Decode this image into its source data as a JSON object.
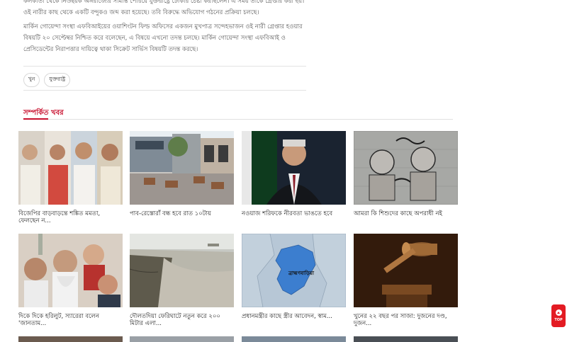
{
  "article": {
    "paragraphs": [
      "কলকাতা থেকে নিউইয়র্ক অঙ্গরাজ্যের সীমান্ত পেরিয়ে যুক্তরাষ্ট্রে ঢোকার চেষ্টা করছিলেন। এ সময় তাকে গ্রেপ্তার করা হয়। ওই নারীর কাছ থেকে একটি বন্দুকও জব্দ করা হয়েছে। তবি বিরুদ্ধে অভিযোগ গঠনের প্রক্রিয়া চলছে।",
      "মার্কিন গোয়েন্দা সংস্থা এফবিআইয়ের ওয়াশিংটন ফিল্ড অফিসের একজন মুখপাত্র সন্দেহভাজন ওই নারী গ্রেপ্তার হওয়ার বিষয়টি ২০ সেপ্টেম্বর নিশ্চিত করে বলেছেন, এ বিষয়ে এখনো তদন্ত চলছে। মার্কিন গোয়েন্দা সংস্থা এফবিআই ও প্রেসিডেন্টের নিরাপত্তার দায়িত্বে থাকা সিক্রেট সার্ভিস বিষয়টি তদন্ত করছে।"
    ],
    "tags": [
      "খুন",
      "যুক্তরাষ্ট্র"
    ]
  },
  "related": {
    "title": "সম্পর্কিত খবর",
    "items": [
      {
        "caption": "বিজেপির বাড়বাড়ন্তে শঙ্কিত মমতা, ফেলছেন ন...",
        "icon": "politicians-photo"
      },
      {
        "caption": "পাব-রেস্তোরাঁ বন্ধ হবে রাত ১০টায়",
        "icon": "street-cafe-photo"
      },
      {
        "caption": "নওয়াজ শরিফকে নীরবতা ভাঙতে হবে",
        "icon": "nawaz-sharif-photo"
      },
      {
        "caption": "আমরা কি শিশুদের কাছে অপরাধী নই",
        "icon": "children-graffiti-photo"
      },
      {
        "caption": "দিকে দিকে হরিলুট, স্যারেরা বলেন 'জানতাম...",
        "icon": "politicians-collage-photo"
      },
      {
        "caption": "দৌলতদিয়া ফেরিঘাটে নতুন করে ২০০ মিটার এলা...",
        "icon": "river-erosion-photo"
      },
      {
        "caption": "প্রধানমন্ত্রীর কাছে স্ত্রীর আবেদন, স্বাম...",
        "icon": "map-photo"
      },
      {
        "caption": "খুনের ২২ বছর পর সাজা: দুজনের দণ্ড, দুজন...",
        "icon": "judge-gavel-photo"
      }
    ],
    "map_label": "ব্রাহ্মণবাড়িয়া"
  },
  "top_button": {
    "label": "TOP"
  },
  "colors": {
    "accent": "#c8102e",
    "top_button": "#e31b23"
  }
}
